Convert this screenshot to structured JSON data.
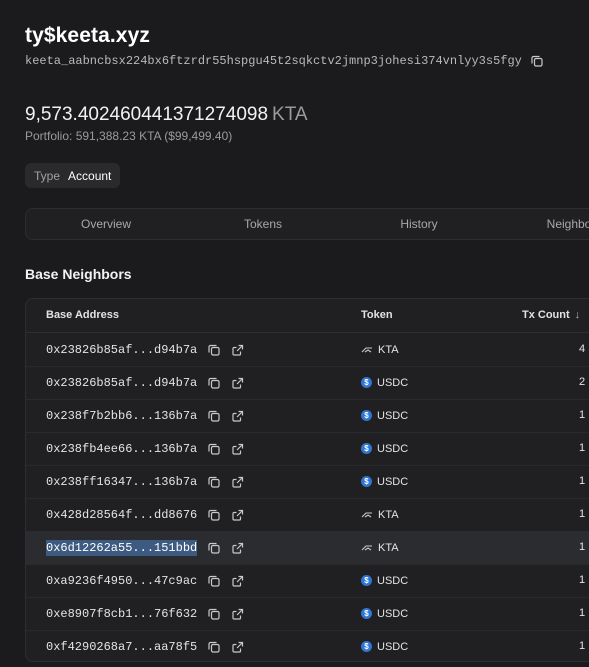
{
  "account": {
    "name": "ty$keeta.xyz",
    "address": "keeta_aabncbsx224bx6ftzrdr55hspgu45t2sqkctv2jmnp3johesi374vnlyy3s5fgy",
    "balance": "9,573.402460441371274098",
    "balance_unit": "KTA",
    "portfolio": "Portfolio: 591,388.23 KTA ($99,499.40)",
    "type_label": "Type",
    "type_value": "Account"
  },
  "tabs": [
    "Overview",
    "Tokens",
    "History",
    "Neighbors"
  ],
  "section_title": "Base Neighbors",
  "table": {
    "headers": {
      "address": "Base Address",
      "token": "Token",
      "tx_count": "Tx Count"
    },
    "sort_icon": "arrow-down-icon",
    "rows": [
      {
        "address": "0x23826b85af...d94b7a",
        "token": "KTA",
        "tx": "4"
      },
      {
        "address": "0x23826b85af...d94b7a",
        "token": "USDC",
        "tx": "2"
      },
      {
        "address": "0x238f7b2bb6...136b7a",
        "token": "USDC",
        "tx": "1"
      },
      {
        "address": "0x238fb4ee66...136b7a",
        "token": "USDC",
        "tx": "1"
      },
      {
        "address": "0x238ff16347...136b7a",
        "token": "USDC",
        "tx": "1"
      },
      {
        "address": "0x428d28564f...dd8676",
        "token": "KTA",
        "tx": "1"
      },
      {
        "address": "0x6d12262a55...151bbd",
        "token": "KTA",
        "tx": "1"
      },
      {
        "address": "0xa9236f4950...47c9ac",
        "token": "USDC",
        "tx": "1"
      },
      {
        "address": "0xe8907f8cb1...76f632",
        "token": "USDC",
        "tx": "1"
      },
      {
        "address": "0xf4290268a7...aa78f5",
        "token": "USDC",
        "tx": "1"
      }
    ],
    "selected_row": 6
  },
  "colors": {
    "background": "#1b1b1d",
    "panel": "#202022",
    "usdc": "#2f76d2",
    "selection": "#3d5a80"
  }
}
